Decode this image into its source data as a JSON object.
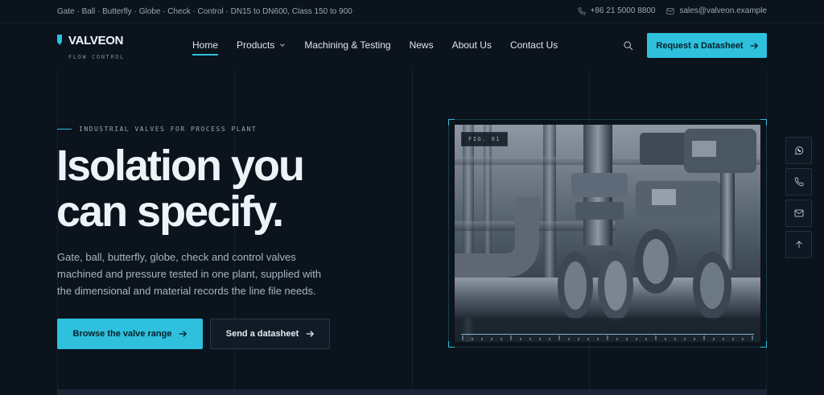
{
  "topbar": {
    "spec_line": "Gate · Ball · Butterfly · Globe · Check · Control · DN15 to DN600, Class 150 to 900",
    "phone": "+86 21 5000 8800",
    "email": "sales@valveon.example"
  },
  "brand": {
    "name": "VALVEON",
    "tagline": "FLOW CONTROL",
    "accent": "#2ec0dc"
  },
  "nav": {
    "items": [
      {
        "label": "Home",
        "active": true
      },
      {
        "label": "Products",
        "dropdown": true
      },
      {
        "label": "Machining & Testing"
      },
      {
        "label": "News"
      },
      {
        "label": "About Us"
      },
      {
        "label": "Contact Us"
      }
    ],
    "search_icon": "search-icon",
    "cta_label": "Request a Datasheet"
  },
  "hero": {
    "eyebrow": "INDUSTRIAL VALVES FOR PROCESS PLANT",
    "headline_line1": "Isolation you",
    "headline_line2": "can specify.",
    "lede": "Gate, ball, butterfly, globe, check and control valves machined and pressure tested in one plant, supplied with the dimensional and material records the line file needs.",
    "primary_cta": "Browse the valve range",
    "secondary_cta": "Send a datasheet",
    "figure_label": "FIG. 01"
  },
  "dock": {
    "items": [
      "whatsapp-icon",
      "phone-icon",
      "mail-icon",
      "arrow-up-icon"
    ]
  }
}
